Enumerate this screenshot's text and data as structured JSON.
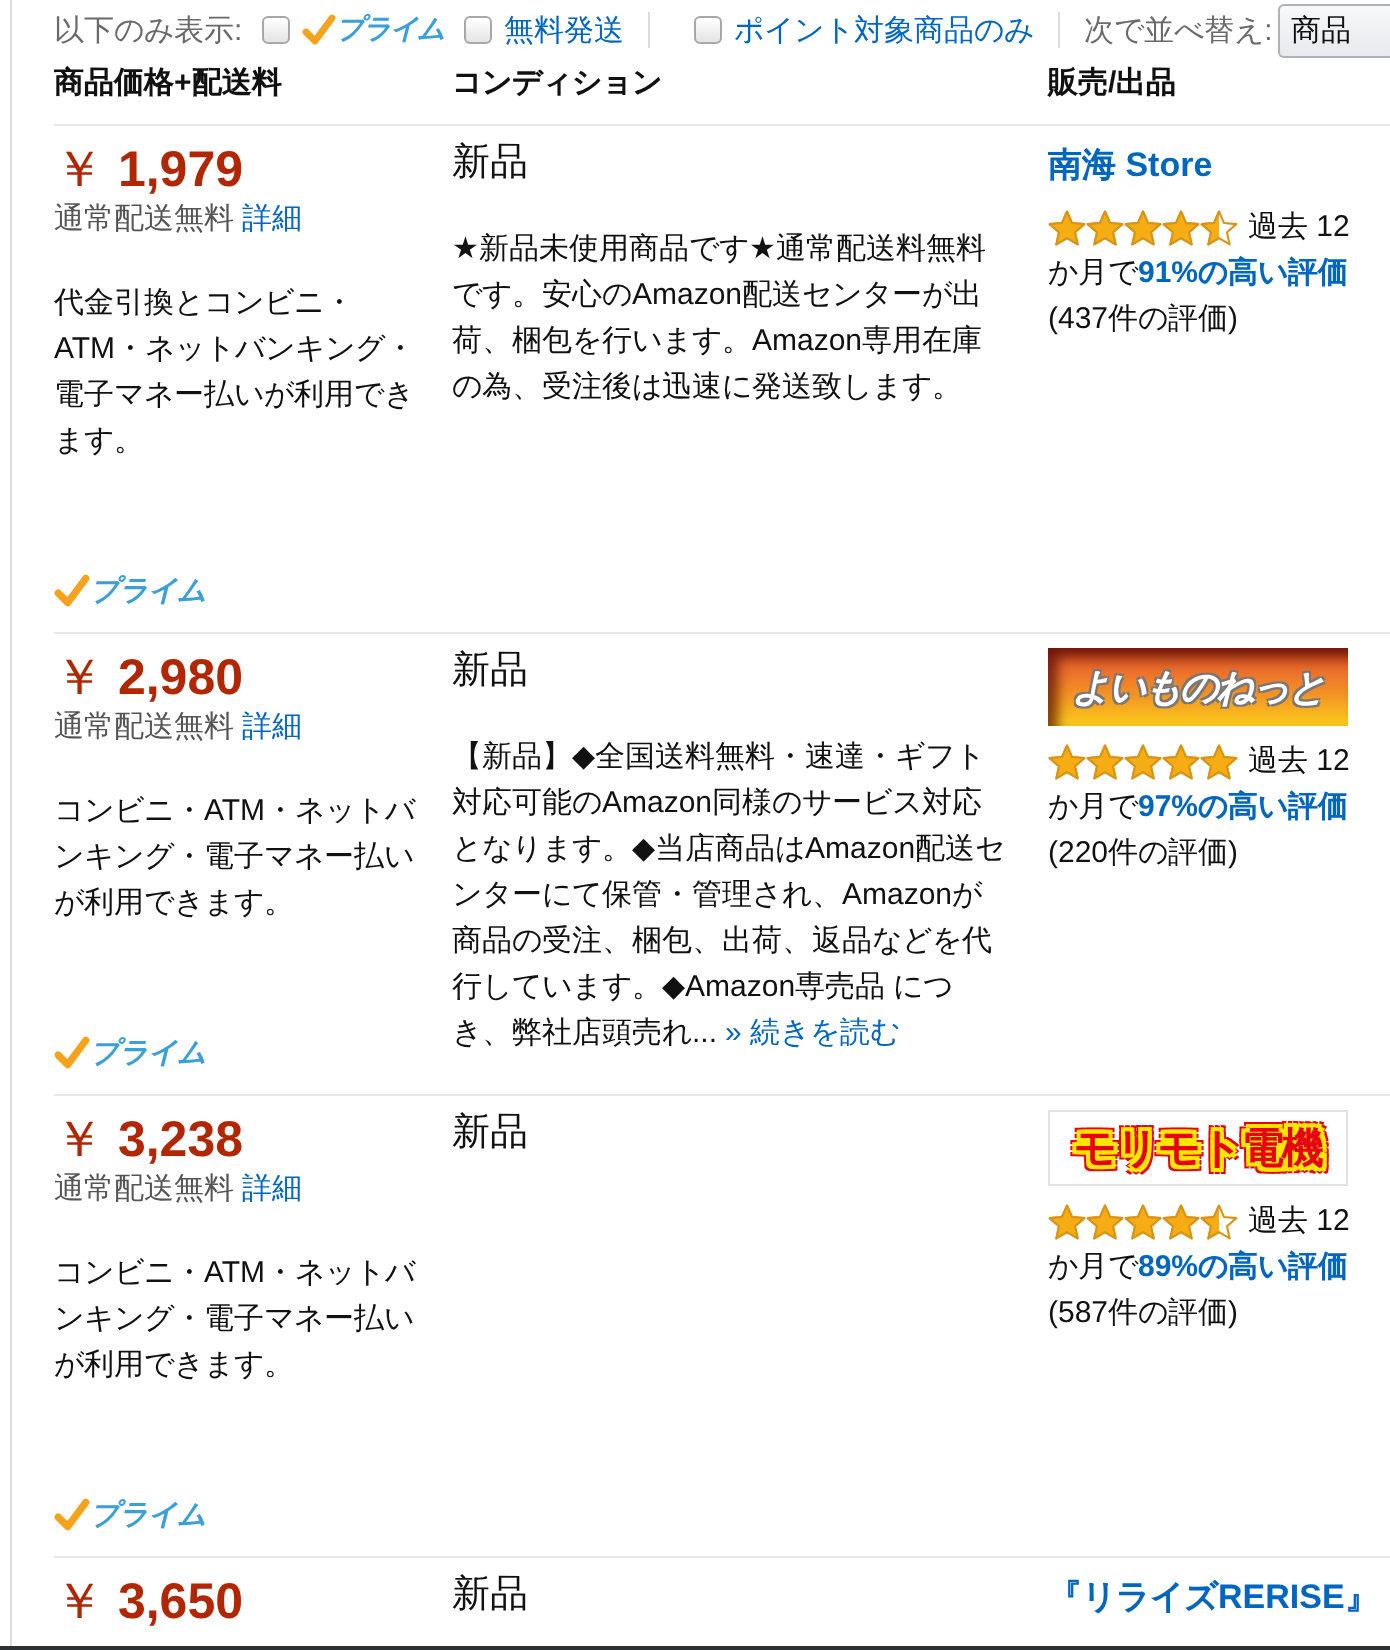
{
  "filter_bar": {
    "label": "以下のみ表示:",
    "filter_groups": [
      {
        "filters": [
          {
            "kind": "prime",
            "label": "プライム",
            "checked": false
          },
          {
            "kind": "link",
            "label": "無料発送",
            "checked": false
          }
        ]
      },
      {
        "filters": [
          {
            "kind": "link",
            "label": "ポイント対象商品のみ",
            "checked": false
          }
        ]
      }
    ],
    "sort_label": "次で並べ替え:",
    "sort_value": "商品"
  },
  "columns": [
    "商品価格+配送料",
    "コンディション",
    "販売/出品"
  ],
  "offers": [
    {
      "price": "￥ **1,979**",
      "shipping": "通常配送無料",
      "details_link": "詳細",
      "payment": "代金引換とコンビニ・ATM・ネットバンキング・電子マネー払いが利用できます。",
      "prime": "プライム",
      "condition": "新品",
      "description": "★新品未使用商品です★通常配送料無料です。安心のAmazon配送センターが出荷、梱包を行います。Amazon専用在庫の為、受注後は迅速に発送致します。",
      "seller": {
        "kind": "link",
        "name": "南海 Store"
      },
      "rating": {
        "stars": 4.5,
        "period_start": "過去 12",
        "period_end": "か月で",
        "positive": "91%の高い評価",
        "count": "(437件の評価)"
      }
    },
    {
      "price": "￥ **2,980**",
      "shipping": "通常配送無料",
      "details_link": "詳細",
      "payment": "コンビニ・ATM・ネットバンキング・電子マネー払いが利用できます。",
      "prime": "プライム",
      "condition": "新品",
      "description": "【新品】◆全国送料無料・速達・ギフト対応可能のAmazon同様のサービス対応となります。◆当店商品はAmazon配送センターにて保管・管理され、Amazonが商品の受注、梱包、出荷、返品などを代行しています。◆Amazon専売品 につき、弊社店頭売れ...",
      "more_link": "» 続きを読む",
      "seller": {
        "kind": "banner",
        "name": "よいものねっと"
      },
      "rating": {
        "stars": 5,
        "period_start": "過去 12",
        "period_end": "か月で",
        "positive": "97%の高い評価",
        "count": "(220件の評価)"
      }
    },
    {
      "price": "￥ **3,238**",
      "shipping": "通常配送無料",
      "details_link": "詳細",
      "payment": "コンビニ・ATM・ネットバンキング・電子マネー払いが利用できます。",
      "prime": "プライム",
      "condition": "新品",
      "seller": {
        "kind": "logo",
        "name": "モリモト電機"
      },
      "rating": {
        "stars": 4.5,
        "period_start": "過去 12",
        "period_end": "か月で",
        "positive": "89%の高い評価",
        "count": "(587件の評価)"
      }
    },
    {
      "price": "￥ **3,650**",
      "condition": "新品",
      "seller": {
        "kind": "link",
        "name": "『リライズRERISE』"
      }
    }
  ]
}
